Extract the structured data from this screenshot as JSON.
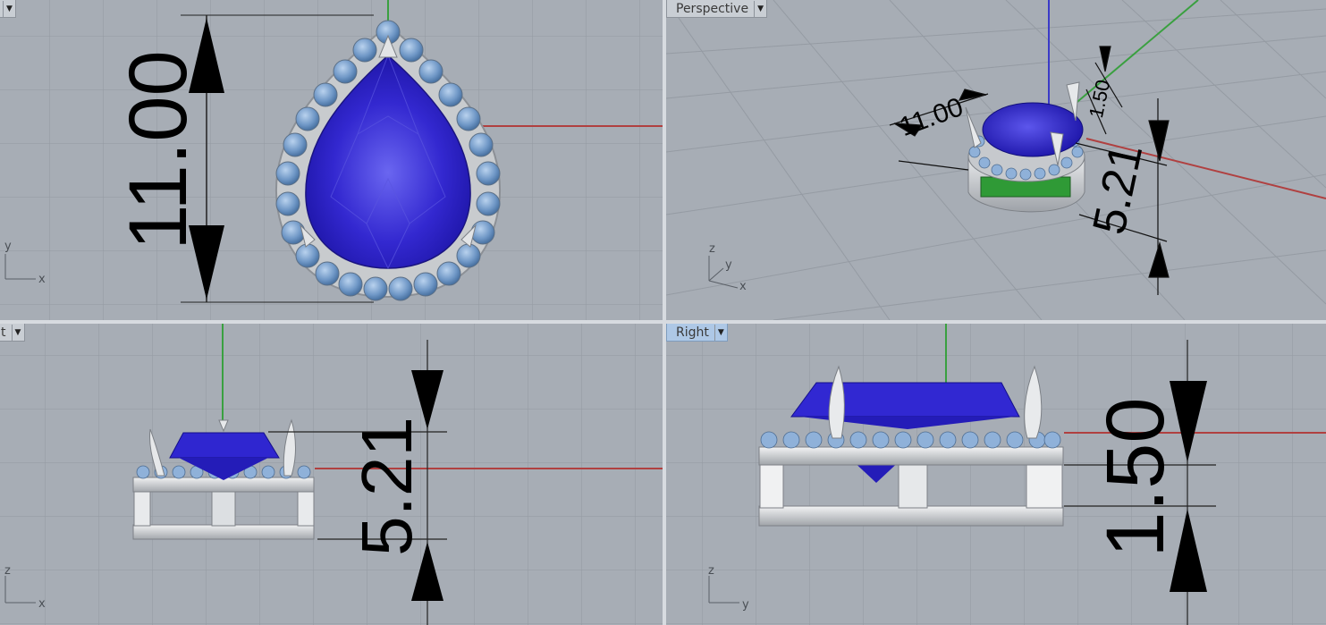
{
  "viewports": {
    "top": {
      "tab_label": "",
      "axis_y": "y",
      "axis_x": "x",
      "dimension": "11.00"
    },
    "perspective": {
      "tab_label": "Perspective",
      "axis_z": "z",
      "axis_y": "y",
      "axis_x": "x",
      "dimension_width": "11.00",
      "dimension_height": "5.21",
      "dimension_small": "1.50"
    },
    "front": {
      "tab_label": "t",
      "axis_z": "z",
      "axis_x": "x",
      "dimension": "5.21"
    },
    "right": {
      "tab_label": "Right",
      "axis_z": "z",
      "axis_y": "y",
      "dimension": "1.50"
    }
  },
  "colors": {
    "viewport_bg": "#a7adb5",
    "grid": "#9298a0",
    "gem_blue": "#2b22c8",
    "accent_stone": "#7aa0cc",
    "metal": "#d8dadc",
    "axis_x": "#b04040",
    "axis_y": "#3aa040",
    "axis_z": "#3a3ac8",
    "active_tab": "#aec8e6"
  },
  "icons": {
    "dropdown": "chevron-down-icon"
  }
}
